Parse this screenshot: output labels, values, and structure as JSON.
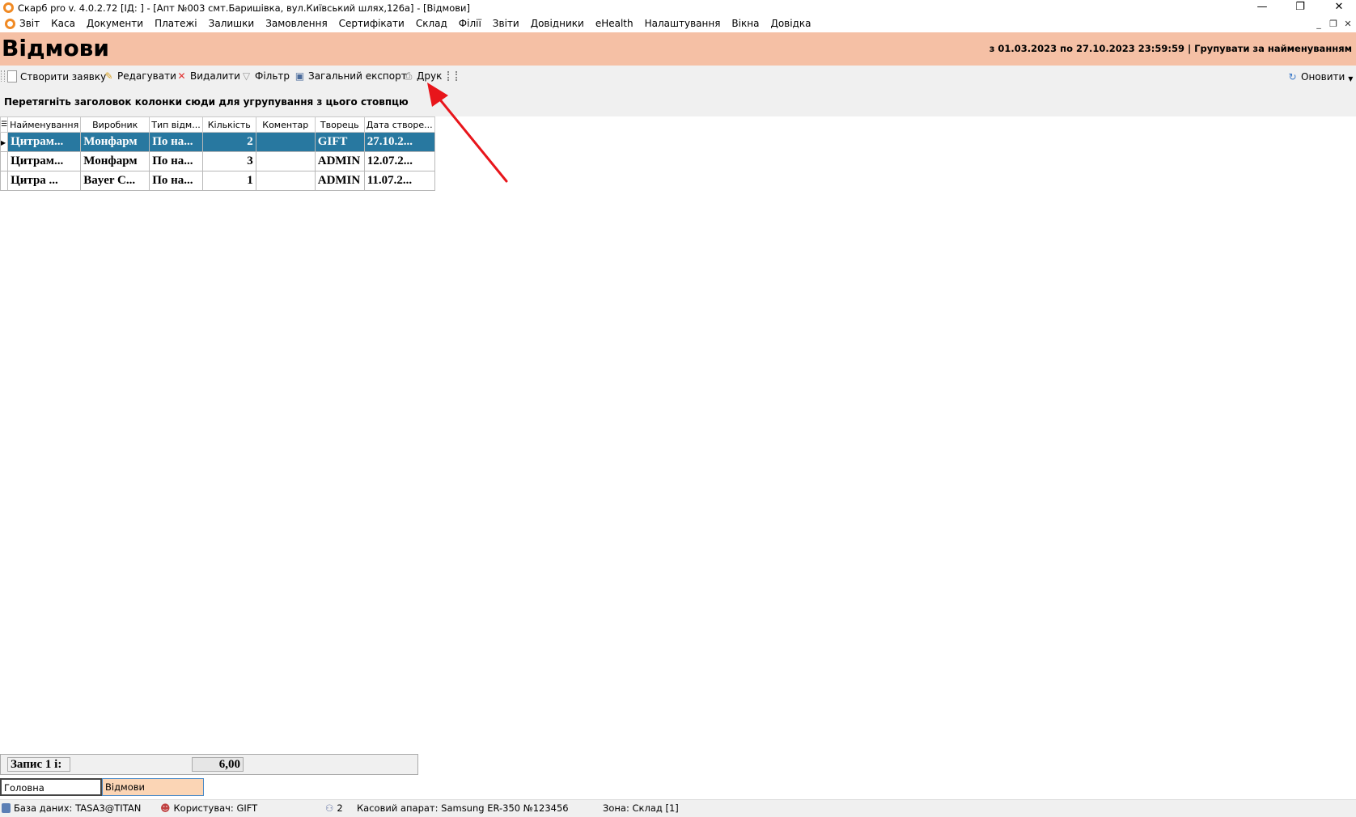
{
  "window": {
    "title": "Скарб pro v. 4.0.2.72 [ІД:        ] - [Апт №003 смт.Баришівка, вул.Київський шлях,126а] - [Відмови]",
    "minimize": "—",
    "restore": "❐",
    "close": "✕"
  },
  "menu": [
    "Звіт",
    "Каса",
    "Документи",
    "Платежі",
    "Залишки",
    "Замовлення",
    "Сертифікати",
    "Склад",
    "Філії",
    "Звіти",
    "Довідники",
    "eHealth",
    "Налаштування",
    "Вікна",
    "Довідка"
  ],
  "mdi": {
    "min": "_",
    "restore": "❐",
    "close": "✕"
  },
  "header": {
    "title": "Відмови",
    "info": "з 01.03.2023 по 27.10.2023 23:59:59  |  Групувати за найменуванням"
  },
  "toolbar": {
    "create": "Створити заявку",
    "edit": "Редагувати",
    "delete": "Видалити",
    "filter": "Фільтр",
    "export": "Загальний експорт",
    "print": "Друк",
    "refresh": "Оновити"
  },
  "group_panel": "Перетягніть заголовок колонки сюди для угрупування з цього стовпцю",
  "grid": {
    "columns": [
      "Найменування",
      "Виробник",
      "Тип відм...",
      "Кількість",
      "Коментар",
      "Творець",
      "Дата створе..."
    ],
    "rows": [
      [
        "Цитрам...",
        "Монфарм",
        "По на...",
        "2",
        "",
        "GIFT",
        "27.10.2..."
      ],
      [
        "Цитрам...",
        "Монфарм",
        "По на...",
        "3",
        "",
        "ADMIN",
        "12.07.2..."
      ],
      [
        "Цитра ...",
        "Bayer C...",
        "По на...",
        "1",
        "",
        "ADMIN",
        "11.07.2..."
      ]
    ]
  },
  "footer": {
    "label": "Запис 1 і:",
    "total": "6,00"
  },
  "tabs": [
    "Головна",
    "Відмови"
  ],
  "status": {
    "db": "База даних: TASA3@TITAN",
    "user": "Користувач: GIFT",
    "count": "2",
    "cash": "Касовий апарат: Samsung ER-350 №123456",
    "zone": "Зона: Склад [1]"
  },
  "colors": {
    "header": "#f5c0a5",
    "selection": "#2878a0",
    "active_tab": "#fbd5b5",
    "arrow": "#e8151b"
  }
}
